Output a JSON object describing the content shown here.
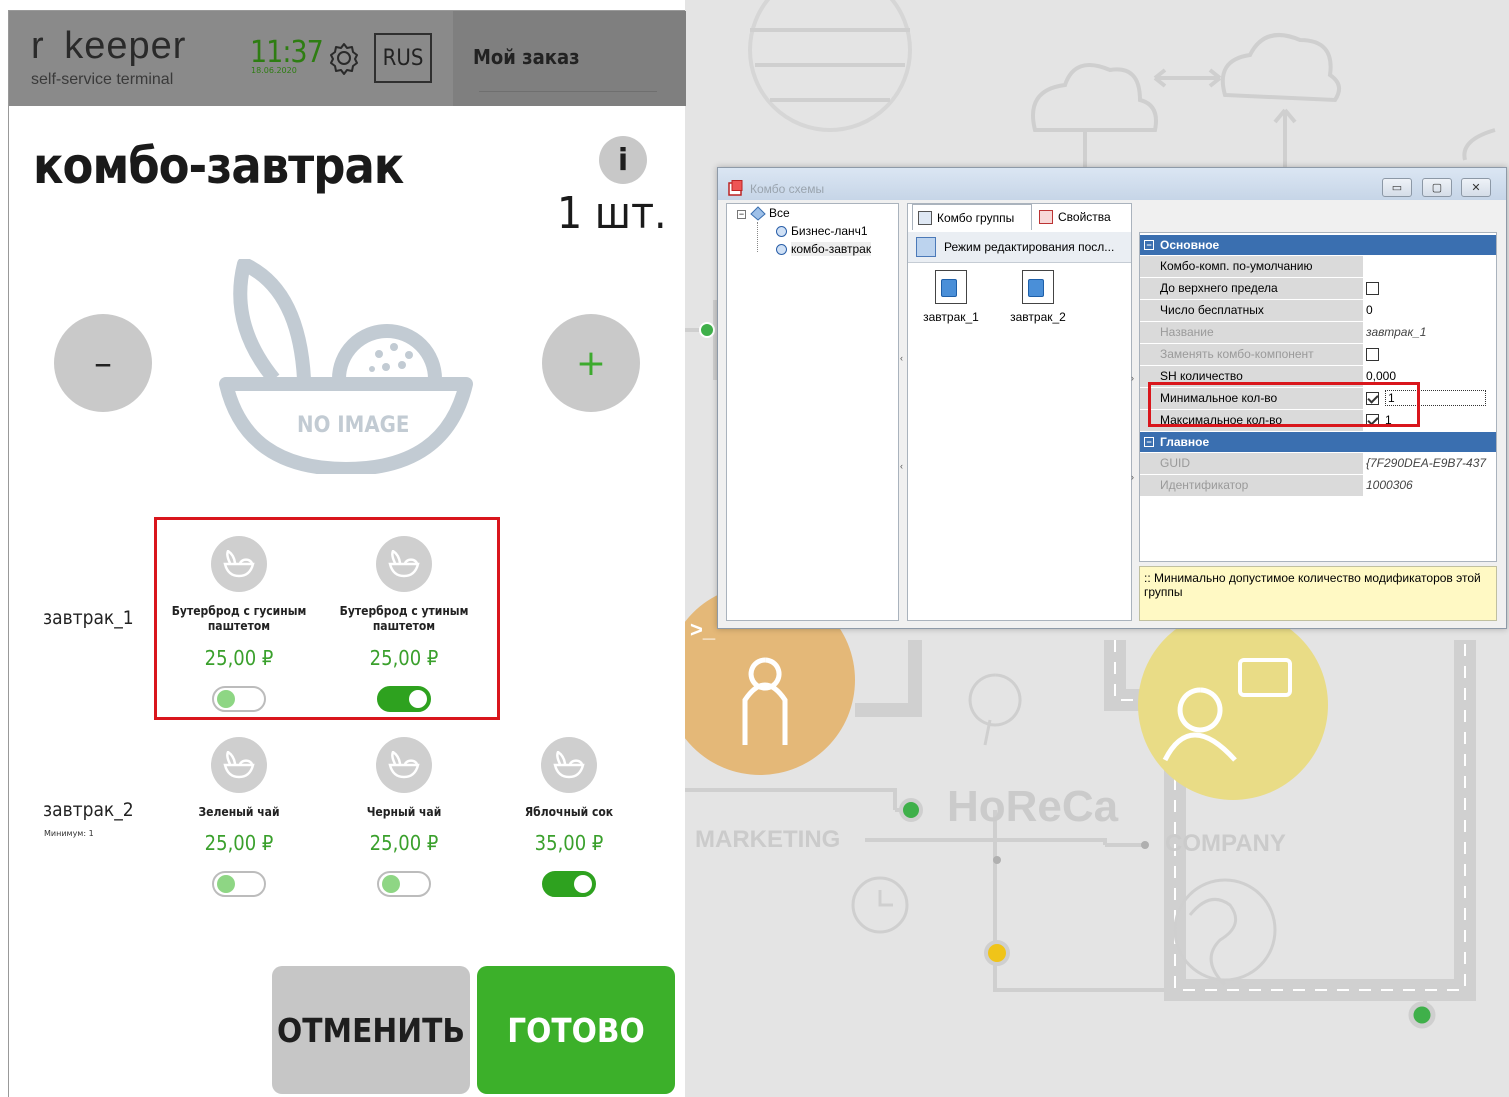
{
  "kiosk": {
    "brand": "r keeper",
    "brand_sub": "self-service terminal",
    "time": "11:37",
    "date": "18.06.2020",
    "lang": "RUS",
    "my_order": "Мой заказ",
    "product_title": "комбо-завтрак",
    "quantity": "1 шт.",
    "info": "i",
    "minus": "–",
    "plus": "+",
    "no_image": "NO IMAGE",
    "groups": [
      {
        "label": "завтрак_1",
        "sub": "",
        "items": [
          {
            "name": "Бутерброд с гусиным паштетом",
            "price": "25,00 ₽",
            "selected": false
          },
          {
            "name": "Бутерброд с утиным паштетом",
            "price": "25,00 ₽",
            "selected": true
          }
        ]
      },
      {
        "label": "завтрак_2",
        "sub": "Минимум: 1",
        "items": [
          {
            "name": "Зеленый чай",
            "price": "25,00 ₽",
            "selected": false
          },
          {
            "name": "Черный чай",
            "price": "25,00 ₽",
            "selected": false
          },
          {
            "name": "Яблочный сок",
            "price": "35,00 ₽",
            "selected": true
          }
        ]
      }
    ],
    "cancel": "ОТМЕНИТЬ",
    "done": "ГОТОВО",
    "colors": {
      "accent": "#3cb02a",
      "price": "#3aa02c",
      "highlight": "#d9161c"
    }
  },
  "background": {
    "labels": [
      "HoReCa",
      "MARKETING",
      "COMPANY"
    ]
  },
  "dialog": {
    "title": "Комбо схемы",
    "window_buttons": [
      "▭",
      "▢",
      "✕"
    ],
    "tree": {
      "root": "Все",
      "children": [
        "Бизнес-ланч1",
        "комбо-завтрак"
      ]
    },
    "tabs": [
      "Комбо группы",
      "Свойства"
    ],
    "mode_label": "Режим редактирования посл...",
    "combo_groups": [
      "завтрак_1",
      "завтрак_2"
    ],
    "sections": [
      {
        "title": "Основное",
        "rows": [
          {
            "name": "Комбо-комп. по-умолчанию",
            "value": "",
            "check": null,
            "dim": false
          },
          {
            "name": "До верхнего предела",
            "value": "",
            "check": false,
            "dim": false
          },
          {
            "name": "Число бесплатных",
            "value": "0",
            "check": null,
            "dim": false
          },
          {
            "name": "Название",
            "value": "завтрак_1",
            "check": null,
            "dim": true
          },
          {
            "name": "Заменять комбо-компонент",
            "value": "",
            "check": false,
            "dim": true
          },
          {
            "name": "SH количество",
            "value": "0,000",
            "check": null,
            "dim": false
          },
          {
            "name": "Минимальное кол-во",
            "value": "1",
            "check": true,
            "dim": false
          },
          {
            "name": "Максимальное кол-во",
            "value": "1",
            "check": true,
            "dim": false
          }
        ]
      },
      {
        "title": "Главное",
        "rows": [
          {
            "name": "GUID",
            "value": "{7F290DEA-E9B7-437",
            "check": null,
            "dim": true
          },
          {
            "name": "Идентификатор",
            "value": "1000306",
            "check": null,
            "dim": true
          }
        ]
      }
    ],
    "hint": ":: Минимально допустимое количество модификаторов этой группы"
  }
}
